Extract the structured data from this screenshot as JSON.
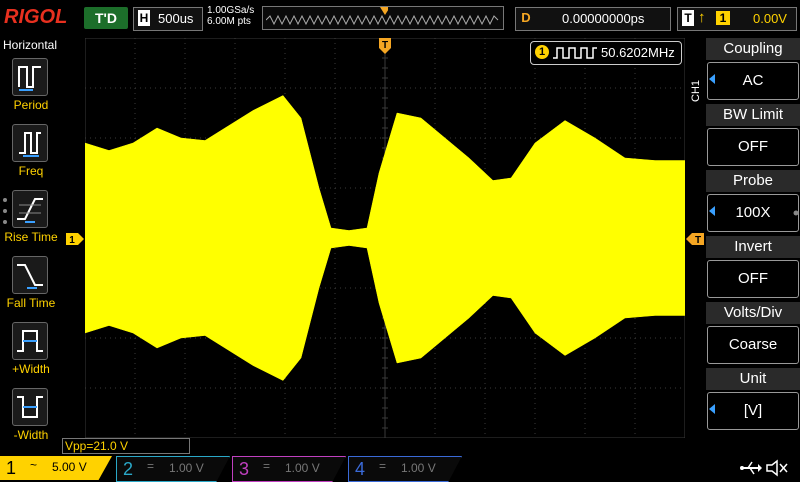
{
  "brand": {
    "logo": "RIGOL"
  },
  "top": {
    "trigger_state": "T'D",
    "horizontal": {
      "key": "H",
      "timebase": "500us"
    },
    "sample_rate": "1.00GSa/s",
    "mem_depth": "6.00M pts",
    "delay": {
      "key": "D",
      "value": "0.00000000ps"
    },
    "trigger": {
      "key": "T",
      "edge_symbol": "↑",
      "source": "1",
      "level": "0.00V"
    }
  },
  "left_menu": {
    "title": "Horizontal",
    "items": [
      {
        "label": "Period"
      },
      {
        "label": "Freq"
      },
      {
        "label": "Rise Time"
      },
      {
        "label": "Fall Time"
      },
      {
        "label": "+Width"
      },
      {
        "label": "-Width"
      }
    ]
  },
  "measure": {
    "ch": "1",
    "frequency": "50.6202MHz",
    "vpp": "Vpp=21.0 V"
  },
  "markers": {
    "trigger_pos": "T",
    "ch1": "1"
  },
  "right_menu": {
    "channel_label": "CH1",
    "items": [
      {
        "title": "Coupling",
        "value": "AC",
        "has_arrow": true
      },
      {
        "title": "BW Limit",
        "value": "OFF",
        "has_arrow": false
      },
      {
        "title": "Probe",
        "value": "100X",
        "has_arrow": true
      },
      {
        "title": "Invert",
        "value": "OFF",
        "has_arrow": false
      },
      {
        "title": "Volts/Div",
        "value": "Coarse",
        "has_arrow": false
      },
      {
        "title": "Unit",
        "value": "[V]",
        "has_arrow": true
      }
    ]
  },
  "channels": [
    {
      "num": "1",
      "coupling": "~",
      "scale": "5.00 V",
      "color": "#ffd200",
      "active": true
    },
    {
      "num": "2",
      "coupling": "=",
      "scale": "1.00 V",
      "color": "#2aa8c8",
      "active": false
    },
    {
      "num": "3",
      "coupling": "=",
      "scale": "1.00 V",
      "color": "#c040c0",
      "active": false
    },
    {
      "num": "4",
      "coupling": "=",
      "scale": "1.00 V",
      "color": "#3a6ad8",
      "active": false
    }
  ],
  "icons": {
    "usb": "usb-icon",
    "speaker": "speaker-muted-icon"
  },
  "colors": {
    "trace": "#ffff00",
    "grid": "#3a3a3a",
    "accent": "#f5a623"
  },
  "waveform": {
    "type": "envelope",
    "upper_env": [
      {
        "t": 0.0,
        "v": 1.9
      },
      {
        "t": 0.04,
        "v": 1.75
      },
      {
        "t": 0.08,
        "v": 1.9
      },
      {
        "t": 0.12,
        "v": 2.2
      },
      {
        "t": 0.16,
        "v": 2.0
      },
      {
        "t": 0.2,
        "v": 1.95
      },
      {
        "t": 0.24,
        "v": 2.25
      },
      {
        "t": 0.28,
        "v": 2.55
      },
      {
        "t": 0.33,
        "v": 2.85
      },
      {
        "t": 0.36,
        "v": 2.4
      },
      {
        "t": 0.39,
        "v": 1.0
      },
      {
        "t": 0.41,
        "v": 0.2
      },
      {
        "t": 0.44,
        "v": 0.15
      },
      {
        "t": 0.47,
        "v": 0.2
      },
      {
        "t": 0.49,
        "v": 1.3
      },
      {
        "t": 0.52,
        "v": 2.5
      },
      {
        "t": 0.56,
        "v": 2.4
      },
      {
        "t": 0.6,
        "v": 2.0
      },
      {
        "t": 0.64,
        "v": 1.6
      },
      {
        "t": 0.68,
        "v": 1.15
      },
      {
        "t": 0.71,
        "v": 1.2
      },
      {
        "t": 0.75,
        "v": 1.9
      },
      {
        "t": 0.8,
        "v": 2.35
      },
      {
        "t": 0.85,
        "v": 2.0
      },
      {
        "t": 0.9,
        "v": 1.6
      },
      {
        "t": 0.95,
        "v": 1.55
      },
      {
        "t": 1.0,
        "v": 1.55
      }
    ]
  }
}
